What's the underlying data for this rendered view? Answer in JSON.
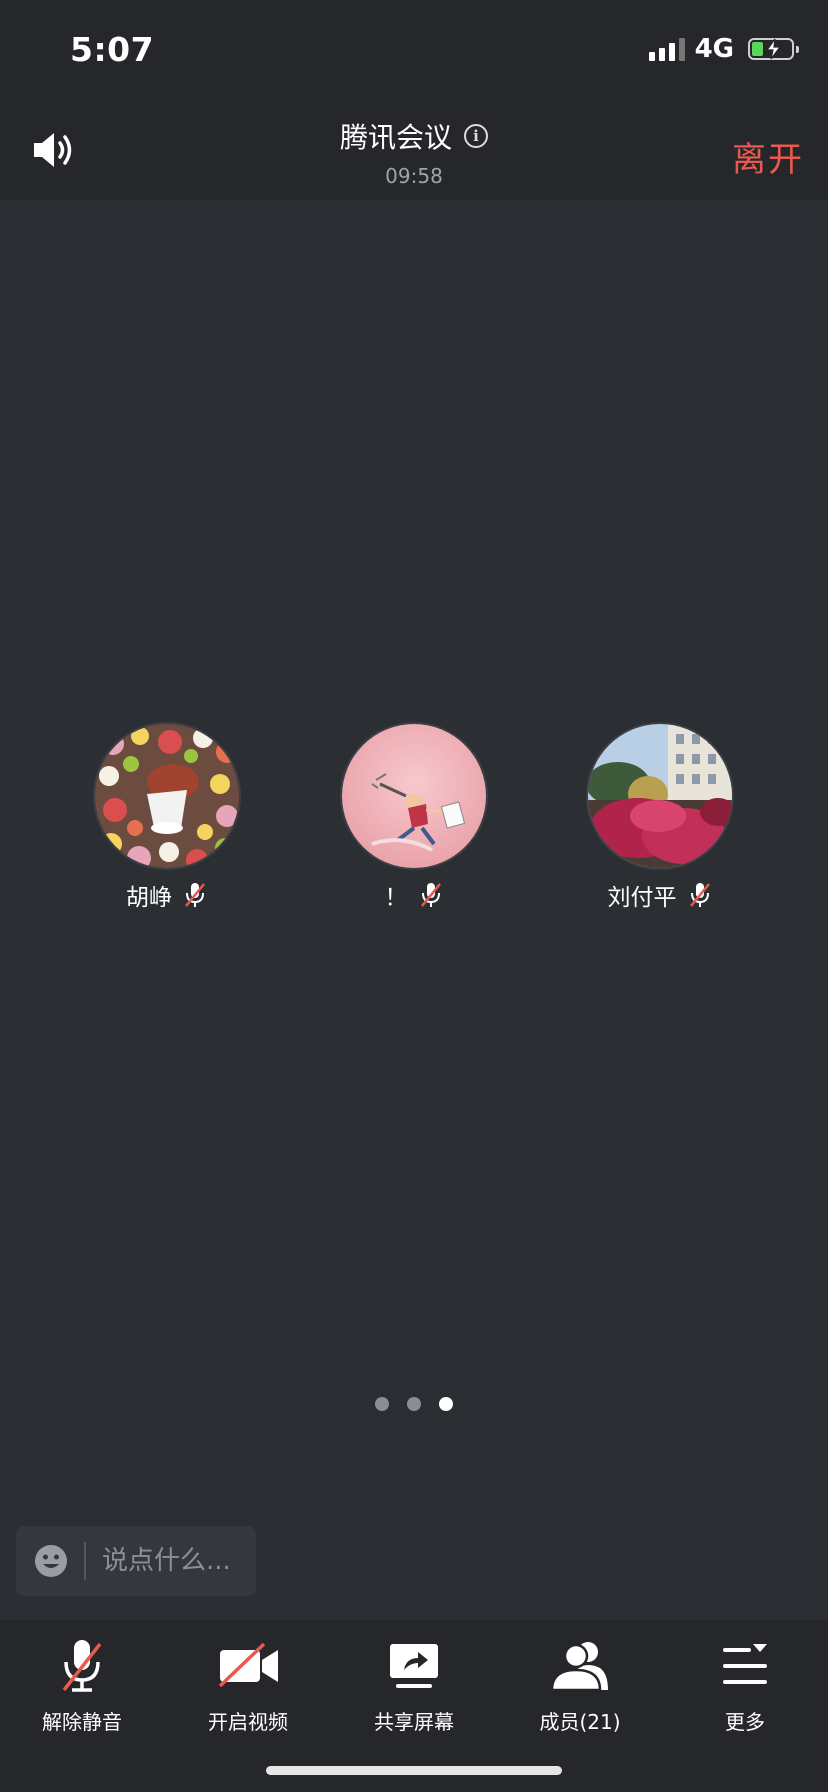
{
  "status_bar": {
    "time": "5:07",
    "network": "4G",
    "battery_level": 0.3,
    "battery_color": "#5ad65c"
  },
  "header": {
    "speaker_icon": "speaker-icon",
    "title": "腾讯会议",
    "info_icon": "info-icon",
    "timer": "09:58",
    "leave_label": "离开",
    "leave_color": "#e85a4f"
  },
  "participants": [
    {
      "name": "胡峥",
      "muted": true,
      "avatar": "floral-avatar"
    },
    {
      "name": "！",
      "muted": true,
      "avatar": "pink-drawing-avatar"
    },
    {
      "name": "刘付平",
      "muted": true,
      "avatar": "garden-photo-avatar"
    }
  ],
  "pager": {
    "pages": 3,
    "current_page": 3
  },
  "chat": {
    "emoji_icon": "emoji-icon",
    "placeholder": "说点什么..."
  },
  "toolbar": {
    "unmute_label": "解除静音",
    "video_label": "开启视频",
    "share_label": "共享屏幕",
    "members_label": "成员(21)",
    "more_label": "更多"
  }
}
